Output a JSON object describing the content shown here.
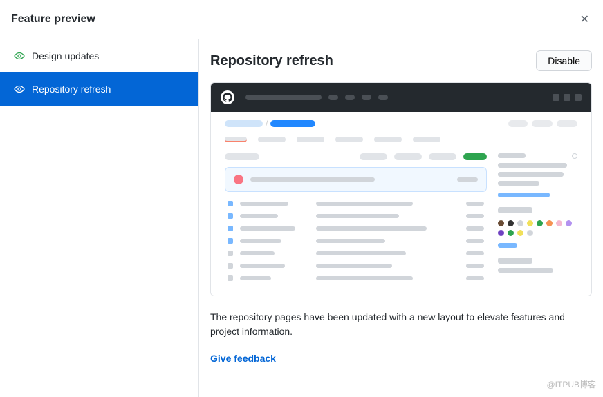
{
  "header": {
    "title": "Feature preview"
  },
  "sidebar": {
    "items": [
      {
        "label": "Design updates",
        "selected": false
      },
      {
        "label": "Repository refresh",
        "selected": true
      }
    ]
  },
  "main": {
    "title": "Repository refresh",
    "disable_label": "Disable",
    "description": "The repository pages have been updated with a new layout to elevate features and project information.",
    "feedback_label": "Give feedback"
  },
  "watermark": "@ITPUB博客",
  "lang_colors": [
    "#6a4c35",
    "#333",
    "#d1d5da",
    "#f1e05a",
    "#2ea44f",
    "#f69253",
    "#f4b8d0",
    "#b392f0",
    "#6f42c1",
    "#2ea44f",
    "#f1e05a",
    "#d1d5da"
  ]
}
